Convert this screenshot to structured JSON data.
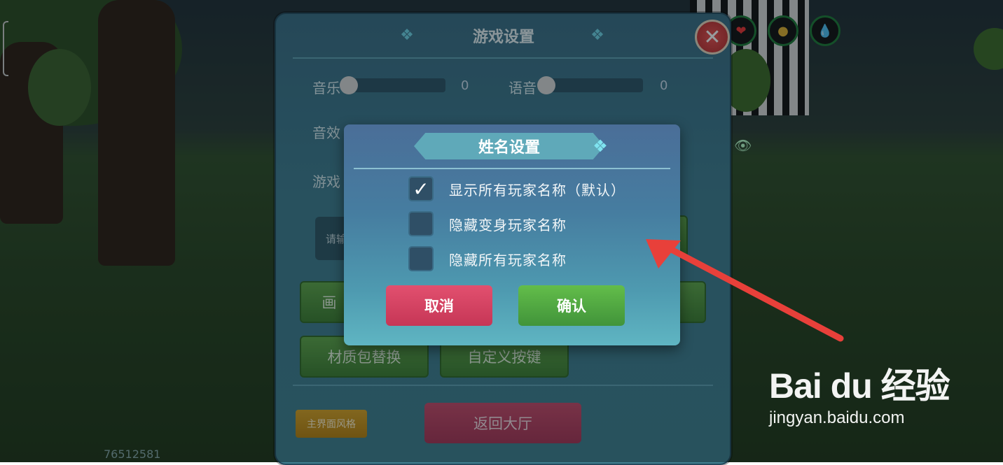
{
  "game_settings": {
    "title": "游戏设置",
    "music_label": "音乐",
    "music_value": "0",
    "voice_label": "语音",
    "voice_value": "0",
    "sfx_label": "音效",
    "game_label": "游戏",
    "input_partial": "请输",
    "button_graphics": "画",
    "button_texture_pack": "材质包替换",
    "button_custom_keys": "自定义按键",
    "button_main_style": "主界面风格",
    "button_return_lobby": "返回大厅",
    "user_id": "76512581"
  },
  "name_dialog": {
    "title": "姓名设置",
    "options": [
      {
        "label": "显示所有玩家名称（默认）",
        "checked": true
      },
      {
        "label": "隐藏变身玩家名称",
        "checked": false
      },
      {
        "label": "隐藏所有玩家名称",
        "checked": false
      }
    ],
    "cancel_label": "取消",
    "confirm_label": "确认"
  },
  "watermark": {
    "logo": "Bai du 经验",
    "url": "jingyan.baidu.com"
  },
  "colors": {
    "annotation_arrow": "#e8403a",
    "cancel_button": "#d6445f",
    "confirm_button": "#55a843"
  }
}
